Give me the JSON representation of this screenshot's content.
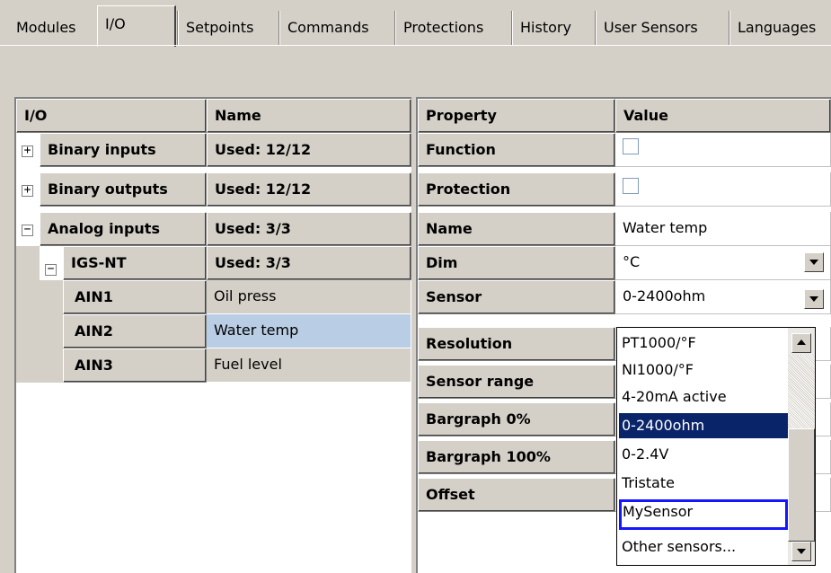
{
  "tabs": [
    {
      "label": "Modules"
    },
    {
      "label": "I/O",
      "active": true
    },
    {
      "label": "Setpoints"
    },
    {
      "label": "Commands"
    },
    {
      "label": "Protections"
    },
    {
      "label": "History"
    },
    {
      "label": "User Sensors"
    },
    {
      "label": "Languages"
    }
  ],
  "io_table": {
    "headers": {
      "io": "I/O",
      "name": "Name"
    },
    "rows": [
      {
        "label": "Binary inputs",
        "value": "Used: 12/12",
        "expander": "+"
      },
      {
        "label": "Binary outputs",
        "value": "Used: 12/12",
        "expander": "+"
      },
      {
        "label": "Analog inputs",
        "value": "Used: 3/3",
        "expander": "−"
      },
      {
        "label": "IGS-NT",
        "value": "Used: 3/3",
        "expander": "−"
      },
      {
        "label": "AIN1",
        "value": "Oil press"
      },
      {
        "label": "AIN2",
        "value": "Water temp"
      },
      {
        "label": "AIN3",
        "value": "Fuel level"
      }
    ]
  },
  "property_table": {
    "headers": {
      "property": "Property",
      "value": "Value"
    },
    "rows": [
      {
        "property": "Function",
        "value": ""
      },
      {
        "property": "Protection",
        "value": ""
      },
      {
        "property": "Name",
        "value": "Water temp"
      },
      {
        "property": "Dim",
        "value": "°C"
      },
      {
        "property": "Sensor",
        "value": "0-2400ohm"
      },
      {
        "property": "Resolution",
        "value": ""
      },
      {
        "property": "Sensor range",
        "value": ""
      },
      {
        "property": "Bargraph 0%",
        "value": ""
      },
      {
        "property": "Bargraph 100%",
        "value": ""
      },
      {
        "property": "Offset",
        "value": ""
      }
    ]
  },
  "sensor_dropdown": {
    "options": [
      "PT1000/°F",
      "NI1000/°F",
      "4-20mA active",
      "0-2400ohm",
      "0-2.4V",
      "Tristate",
      "MySensor",
      "Other sensors..."
    ],
    "selected": "0-2400ohm",
    "highlighted": "MySensor"
  },
  "colors": {
    "window": "#d4d0c8",
    "selection": "#0a246a",
    "row_selected": "#b9cde5",
    "focus_border": "#1515ff"
  }
}
